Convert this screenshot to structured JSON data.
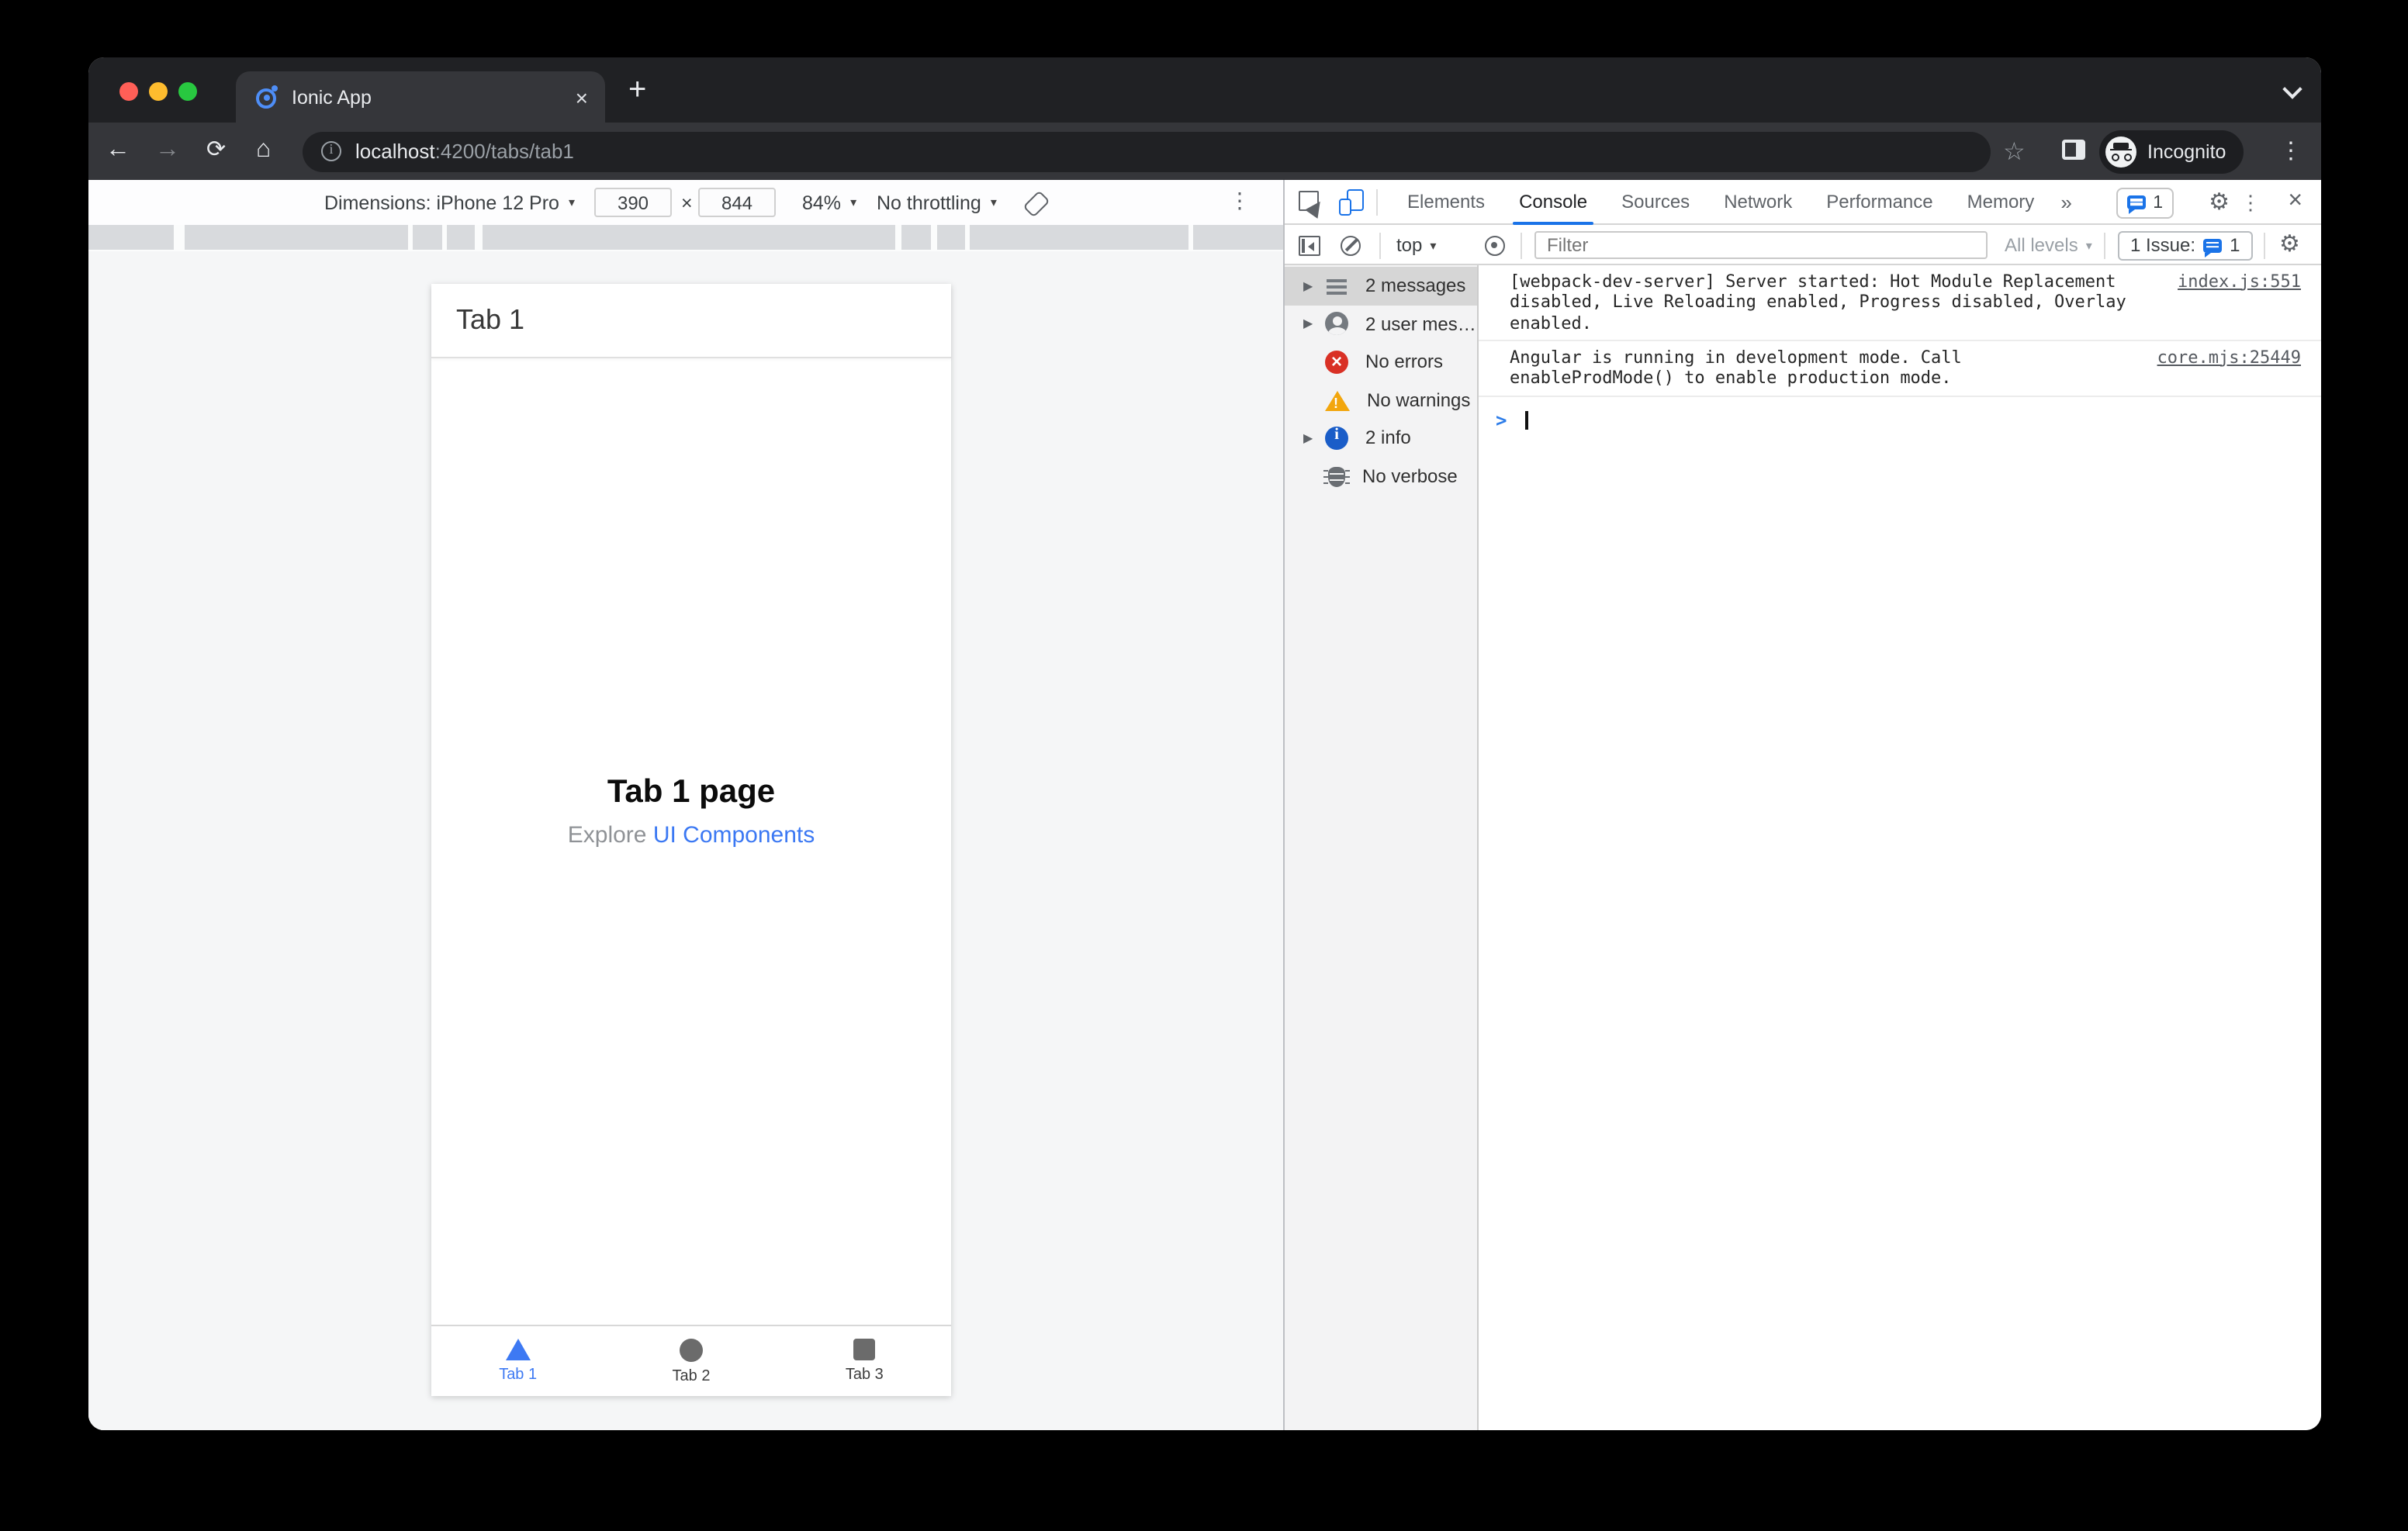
{
  "browser": {
    "tab_title": "Ionic App",
    "url_host": "localhost",
    "url_rest": ":4200/tabs/tab1",
    "incognito_label": "Incognito"
  },
  "device_toolbar": {
    "dimensions_label": "Dimensions: iPhone 12 Pro",
    "width_value": "390",
    "separator": "×",
    "height_value": "844",
    "zoom_value": "84%",
    "throttling_value": "No throttling"
  },
  "devtools": {
    "tabs": {
      "elements": "Elements",
      "console": "Console",
      "sources": "Sources",
      "network": "Network",
      "performance": "Performance",
      "memory": "Memory",
      "more": "»"
    },
    "chat_badge_count": "1",
    "toolbar": {
      "context": "top",
      "filter_placeholder": "Filter",
      "levels": "All levels",
      "issue_label": "1 Issue:",
      "issue_count": "1"
    },
    "sidebar": {
      "messages": "2 messages",
      "user_messages": "2 user mes…",
      "errors": "No errors",
      "warnings": "No warnings",
      "info": "2 info",
      "verbose": "No verbose"
    },
    "console": {
      "msg1_line1": "[webpack-dev-server] Server started: Hot Module Replacement",
      "msg1_line2": "disabled, Live Reloading enabled, Progress disabled, Overlay enabled.",
      "msg1_source": "index.js:551",
      "msg2_line1": "Angular is running in development mode. Call",
      "msg2_line2": "enableProdMode() to enable production mode.",
      "msg2_source": "core.mjs:25449",
      "prompt": ">"
    }
  },
  "app": {
    "header_title": "Tab 1",
    "page_title": "Tab 1 page",
    "explore_text": "Explore",
    "explore_link": "UI Components",
    "tab1_label": "Tab 1",
    "tab2_label": "Tab 2",
    "tab3_label": "Tab 3"
  },
  "colors": {
    "devtools_accent": "#1a73e8",
    "ionic_blue": "#3d79f3",
    "error_red": "#d93025",
    "warning_yellow": "#f2a60d",
    "info_blue": "#1a5dc8",
    "traffic_red": "#ff5f57",
    "traffic_yellow": "#febc2e",
    "traffic_green": "#28c840"
  }
}
